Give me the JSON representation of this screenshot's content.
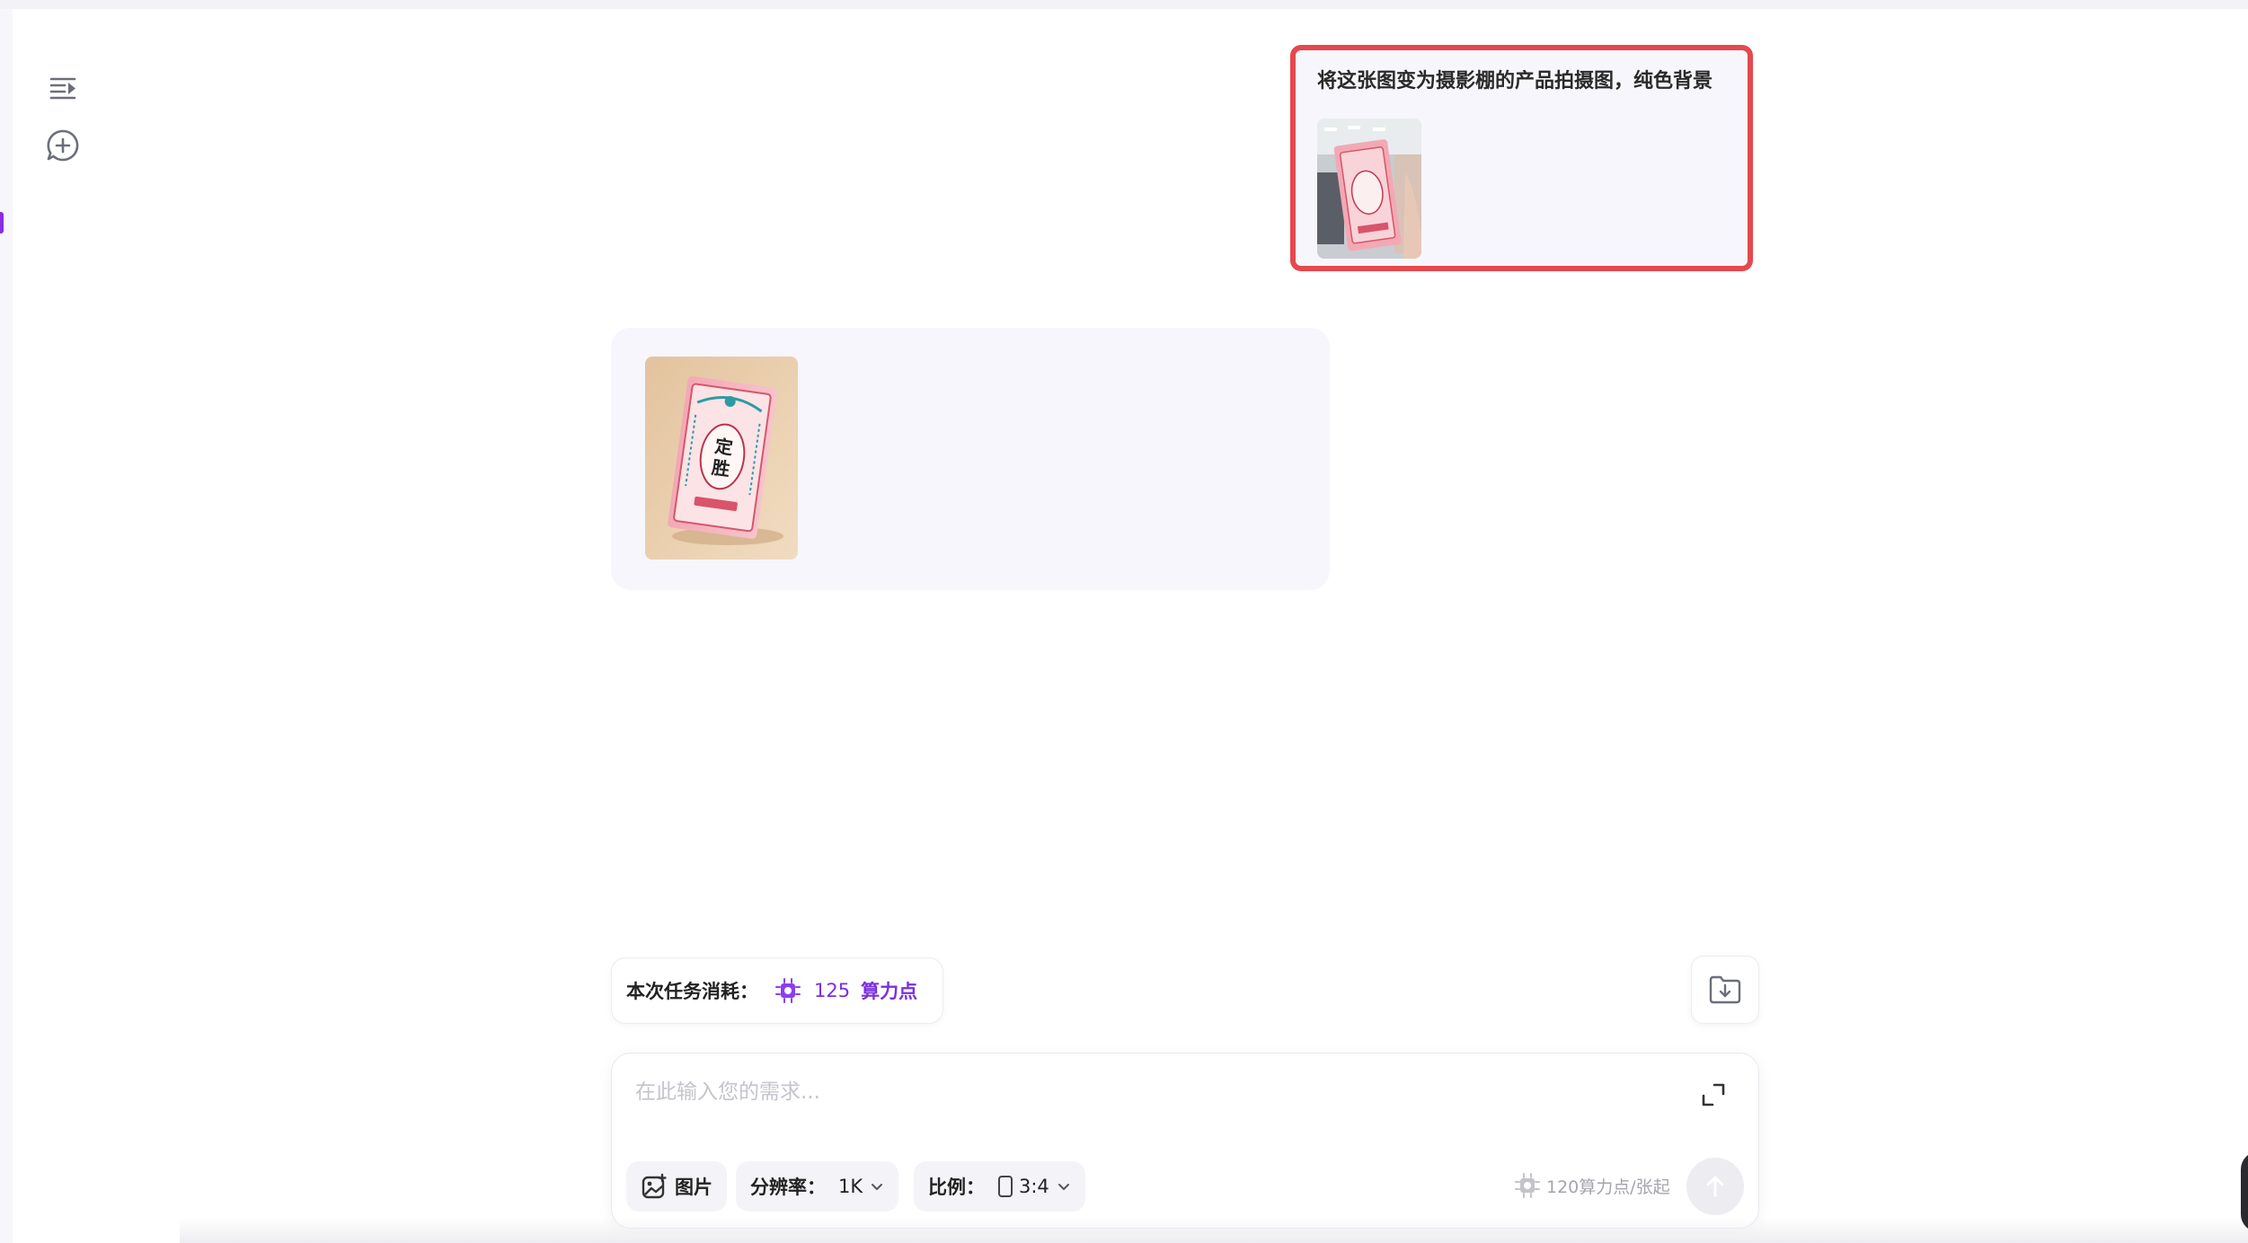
{
  "sidebar": {
    "icons": [
      "menu-expand-icon",
      "new-chat-icon"
    ]
  },
  "conversation": {
    "user_message": {
      "text": "将这张图变为摄影棚的产品拍摄图，纯色背景",
      "attachment_icon": "uploaded-image-thumbnail"
    },
    "assistant_result": {
      "image_label": "定胜"
    }
  },
  "cost": {
    "label": "本次任务消耗：",
    "value": "125",
    "unit": "算力点",
    "icon": "chip-icon"
  },
  "composer": {
    "placeholder": "在此输入您的需求...",
    "image_button_label": "图片",
    "resolution_label": "分辨率：",
    "resolution_value": "1K",
    "ratio_label": "比例：",
    "ratio_value": "3:4",
    "rate_info": "120算力点/张起"
  },
  "colors": {
    "accent_purple": "#7b2fe0",
    "highlight_red": "#e5484d",
    "bubble_bg": "#f6f6fc"
  }
}
